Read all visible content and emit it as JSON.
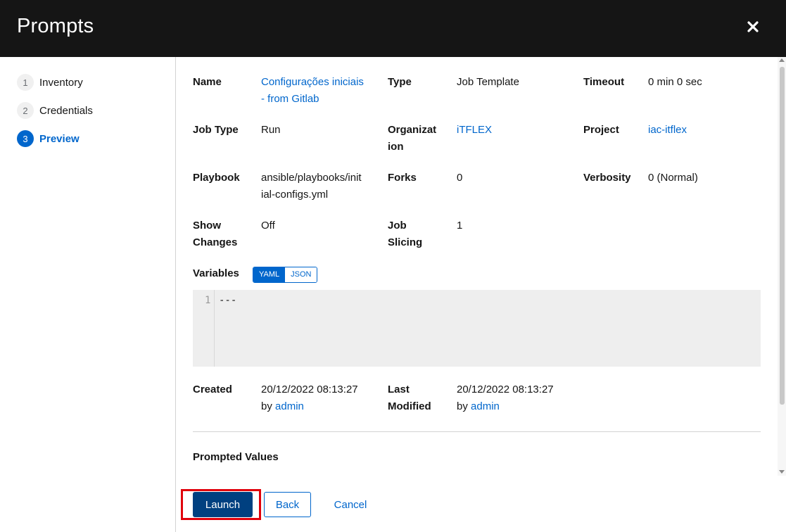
{
  "modal": {
    "title": "Prompts",
    "close_icon": "close-icon"
  },
  "steps": [
    {
      "num": "1",
      "label": "Inventory"
    },
    {
      "num": "2",
      "label": "Credentials"
    },
    {
      "num": "3",
      "label": "Preview"
    }
  ],
  "details": {
    "name_label": "Name",
    "name_line1": "Configurações iniciais",
    "name_line2": "- from Gitlab",
    "type_label": "Type",
    "type_value": "Job Template",
    "timeout_label": "Timeout",
    "timeout_value": "0 min 0 sec",
    "job_type_label": "Job Type",
    "job_type_value": "Run",
    "org_label_line1": "Organizat",
    "org_label_line2": "ion",
    "org_value": "iTFLEX",
    "project_label": "Project",
    "project_value": "iac-itflex",
    "playbook_label": "Playbook",
    "playbook_line1": "ansible/playbooks/init",
    "playbook_line2": "ial-configs.yml",
    "forks_label": "Forks",
    "forks_value": "0",
    "verbosity_label": "Verbosity",
    "verbosity_value": "0 (Normal)",
    "show_changes_line1": "Show",
    "show_changes_line2": "Changes",
    "show_changes_value": "Off",
    "job_slicing_line1": "Job",
    "job_slicing_line2": "Slicing",
    "job_slicing_value": "1",
    "variables_label": "Variables",
    "yaml_label": "YAML",
    "json_label": "JSON",
    "editor_line_number": "1",
    "editor_code": "---",
    "created_label": "Created",
    "created_date": "20/12/2022 08:13:27",
    "created_by_prefix": "by ",
    "created_by": "admin",
    "modified_label_line1": "Last",
    "modified_label_line2": "Modified",
    "modified_date": "20/12/2022 08:13:27",
    "modified_by_prefix": "by ",
    "modified_by": "admin",
    "prompted_values_label": "Prompted Values"
  },
  "footer": {
    "launch_label": "Launch",
    "back_label": "Back",
    "cancel_label": "Cancel"
  },
  "colors": {
    "header_bg": "#151515",
    "accent": "#0066cc",
    "primary_button": "#004080",
    "highlight": "#e0000b"
  }
}
